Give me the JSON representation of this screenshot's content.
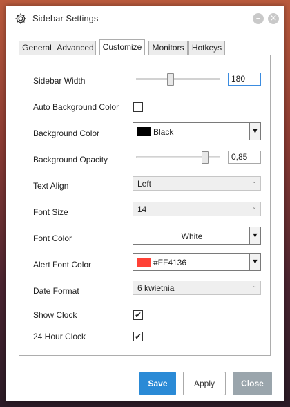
{
  "window": {
    "title": "Sidebar Settings",
    "minimize_glyph": "–",
    "close_glyph": "×"
  },
  "tabs": [
    {
      "label": "General",
      "active": false
    },
    {
      "label": "Advanced",
      "active": false
    },
    {
      "label": "Customize",
      "active": true
    },
    {
      "label": "Monitors",
      "active": false
    },
    {
      "label": "Hotkeys",
      "active": false
    }
  ],
  "settings": {
    "sidebar_width": {
      "label": "Sidebar Width",
      "value": "180",
      "slider_level": 0.4
    },
    "auto_background_color": {
      "label": "Auto Background Color",
      "checked": false
    },
    "background_color": {
      "label": "Background Color",
      "value": "Black",
      "swatch": "#000000"
    },
    "background_opacity": {
      "label": "Background Opacity",
      "value": "0,85",
      "slider_level": 0.85
    },
    "text_align": {
      "label": "Text Align",
      "value": "Left"
    },
    "font_size": {
      "label": "Font Size",
      "value": "14"
    },
    "font_color": {
      "label": "Font Color",
      "value": "White",
      "swatch": "#FFFFFF"
    },
    "alert_font_color": {
      "label": "Alert Font Color",
      "value": "#FF4136",
      "swatch": "#FF4136"
    },
    "date_format": {
      "label": "Date Format",
      "value": "6 kwietnia"
    },
    "show_clock": {
      "label": "Show Clock",
      "checked": true
    },
    "hour24_clock": {
      "label": "24 Hour Clock",
      "checked": true
    }
  },
  "buttons": {
    "save": "Save",
    "apply": "Apply",
    "close": "Close"
  },
  "icons": {
    "gear": "gear-icon",
    "check_mark": "✔",
    "combo_arrow": "▼",
    "dropdown_chevron": "⌄"
  },
  "colors": {
    "accent": "#2A8AD6",
    "close_button": "#9AA5AC"
  }
}
